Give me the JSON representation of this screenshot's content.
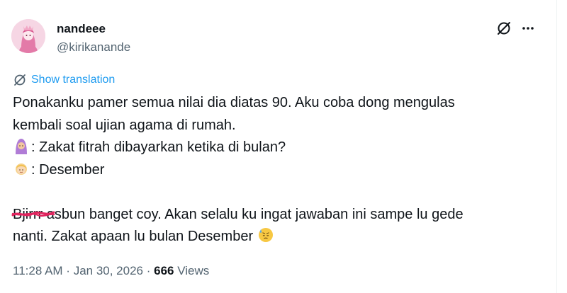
{
  "author": {
    "name": "nandeee",
    "handle": "@kirikanande",
    "avatar_icon": "anime-girl-avatar-icon"
  },
  "actions": {
    "grok_icon": "grok-slashed-circle-icon",
    "more_icon": "more-horizontal-icon"
  },
  "translation": {
    "label": "Show translation",
    "icon": "translate-globe-icon"
  },
  "tweet": {
    "line1": "Ponakanku pamer semua nilai dia diatas 90. Aku coba dong mengulas",
    "line2": "kembali soal ujian agama di rumah.",
    "line3_text": ": Zakat fitrah dibayarkan ketika di bulan?",
    "line3_emoji": "woman-with-headscarf-emoji",
    "line4_text": ": Desember",
    "line4_emoji": "blond-child-emoji",
    "line5_struck": "Bjirrr",
    "line5_text": " asbun banget coy. Akan selalu ku ingat jawaban ini sampe lu gede",
    "line6_text": "nanti. Zakat apaan lu bulan Desember ",
    "line6_emoji": "downcast-face-with-sweat-emoji"
  },
  "meta": {
    "time": "11:28 AM",
    "separator1": " · ",
    "date": "Jan 30, 2026",
    "separator2": " · ",
    "views_count": "666",
    "views_label": " Views"
  },
  "colors": {
    "accent": "#1d9bf0",
    "text": "#0f1419",
    "secondary": "#536471",
    "scribble": "#e0245e"
  }
}
